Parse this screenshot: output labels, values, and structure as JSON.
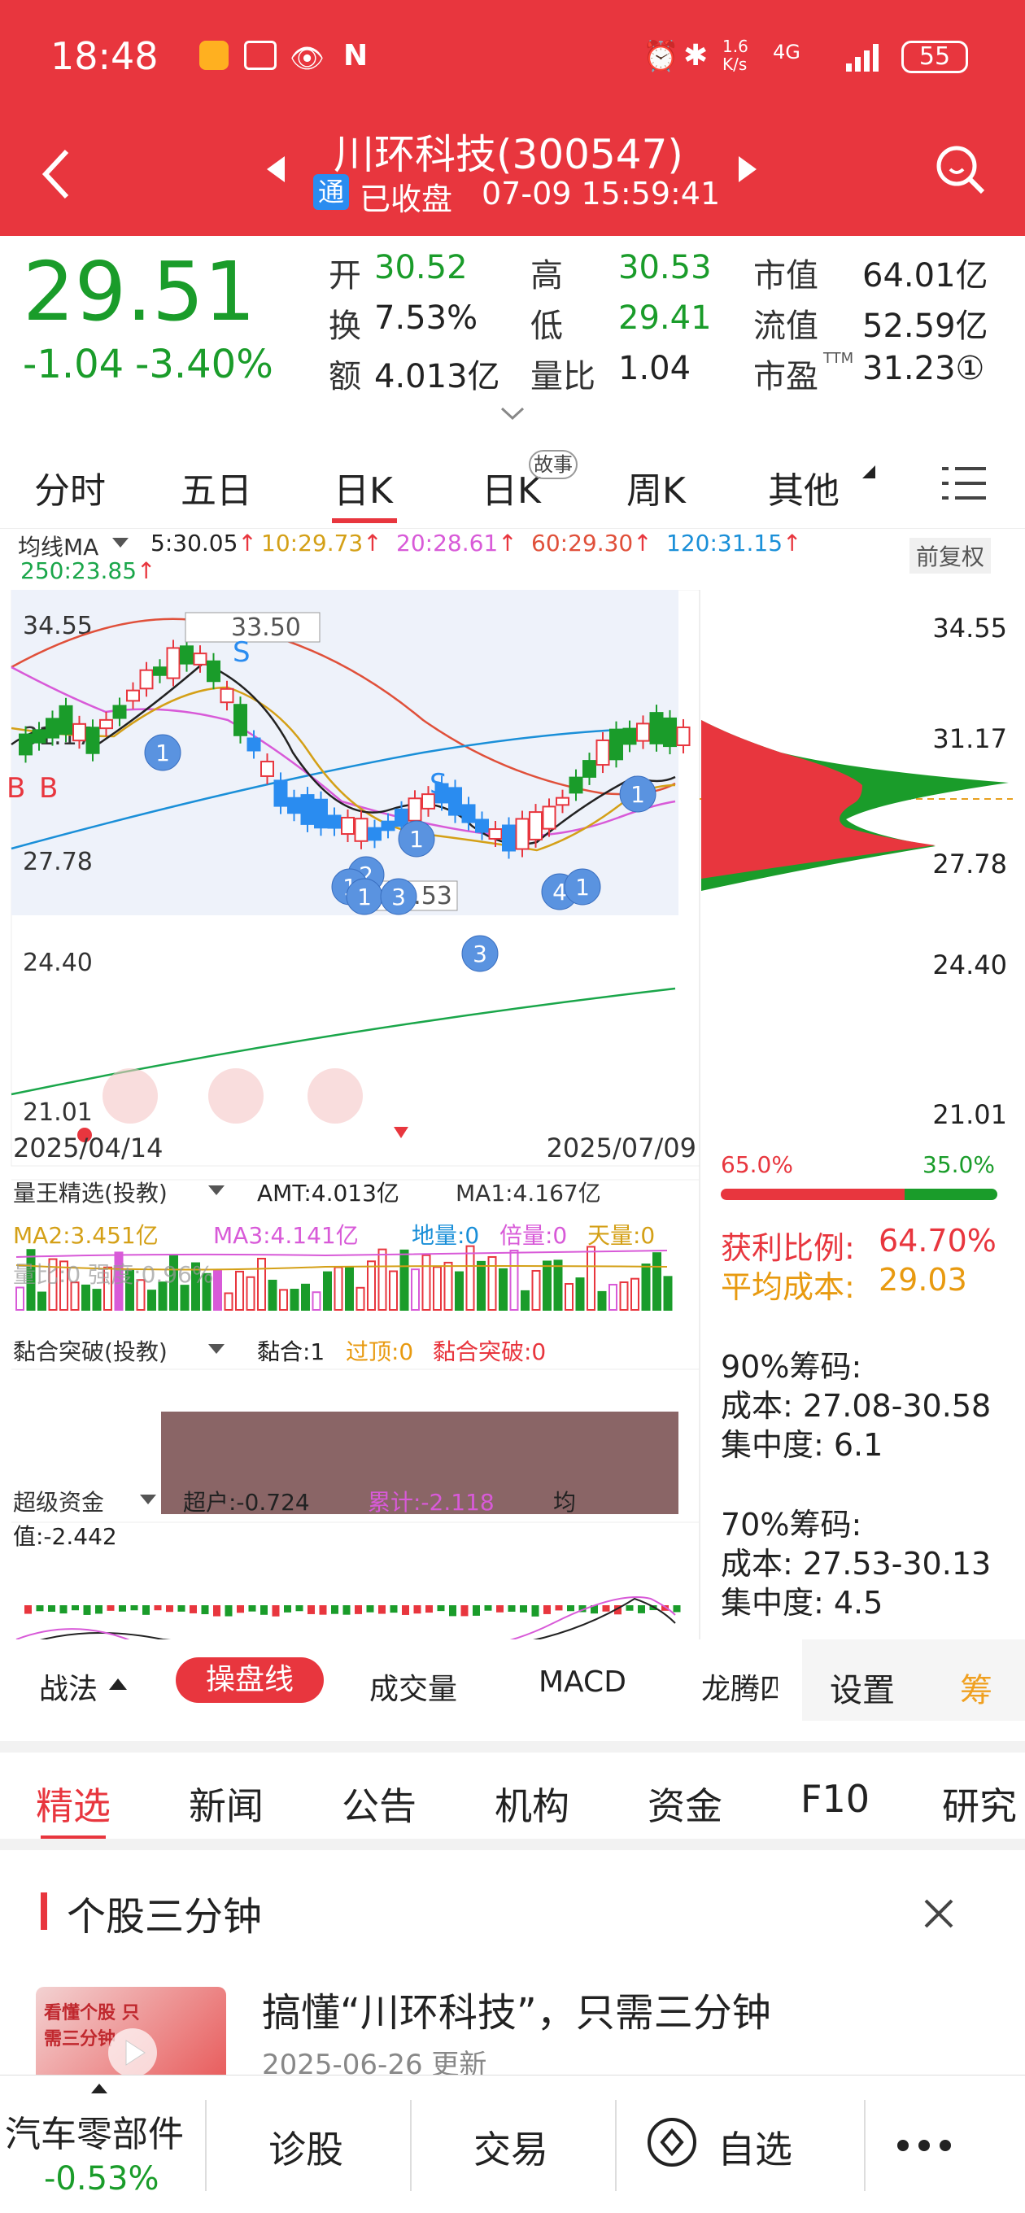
{
  "status": {
    "time": "18:48",
    "speed": "1.6\nK/s",
    "battery": "55",
    "net": "4G"
  },
  "header": {
    "title": "川环科技(300547)",
    "badge": "通",
    "state": "已收盘",
    "datetime": "07-09 15:59:41"
  },
  "quote": {
    "price": "29.51",
    "change": "-1.04",
    "pct": "-3.40%",
    "stats": [
      {
        "label": "开",
        "value": "30.52"
      },
      {
        "label": "高",
        "value": "30.53"
      },
      {
        "label": "市值",
        "value": "64.01亿"
      },
      {
        "label": "换",
        "value": "7.53%"
      },
      {
        "label": "低",
        "value": "29.41"
      },
      {
        "label": "流值",
        "value": "52.59亿"
      },
      {
        "label": "额",
        "value": "4.013亿"
      },
      {
        "label": "量比",
        "value": "1.04"
      },
      {
        "label": "市盈",
        "value": "31.23①"
      }
    ],
    "ttm": "TTM"
  },
  "tabs": [
    "分时",
    "五日",
    "日K",
    "日K",
    "周K",
    "其他"
  ],
  "tabs_badge": "故事",
  "ma": {
    "label": "均线MA",
    "items": [
      {
        "t": "5:30.05",
        "c": "#222"
      },
      {
        "t": "10:29.73",
        "c": "#d4a017"
      },
      {
        "t": "20:28.61",
        "c": "#d85ad8"
      },
      {
        "t": "60:29.30",
        "c": "#e0503a"
      },
      {
        "t": "120:31.15",
        "c": "#1a8fd8"
      },
      {
        "t": "250:23.85",
        "c": "#1aa64a"
      }
    ],
    "adj": "前复权"
  },
  "chart_data": {
    "type": "candlestick",
    "yticks": [
      "34.55",
      "31.17",
      "27.78",
      "24.40",
      "21.01"
    ],
    "dates": [
      "2025/04/14",
      "2025/07/09"
    ],
    "annot_high": "33.50",
    "annot_low": "26.53",
    "markers": [
      "B",
      "B",
      "S",
      "S"
    ],
    "bubbles": [
      "1",
      "1",
      "2",
      "1",
      "1",
      "3",
      "3",
      "4",
      "1",
      "1"
    ]
  },
  "chips": {
    "left_pct": "65.0%",
    "right_pct": "35.0%",
    "profit_label": "获利比例:",
    "profit": "64.70%",
    "avg_label": "平均成本:",
    "avg": "29.03",
    "c90": "90%筹码:",
    "c90cost": "成本: 27.08-30.58",
    "c90conc": "集中度: 6.1",
    "c70": "70%筹码:",
    "c70cost": "成本: 27.53-30.13",
    "c70conc": "集中度: 4.5"
  },
  "vol": {
    "name": "量王精选(投教)",
    "amt": "AMT:4.013亿",
    "ma1": "MA1:4.167亿",
    "ma2": "MA2:3.451亿",
    "ma3": "MA3:4.141亿",
    "di": "地量:0",
    "bei": "倍量:0",
    "tian": "天量:0",
    "row3": "量比:0 强度:0.96%"
  },
  "nian": {
    "name": "黏合突破(投教)",
    "a": "黏合:1",
    "b": "过顶:0",
    "c": "黏合突破:0"
  },
  "fund": {
    "name": "超级资金",
    "a": "超户:-0.724",
    "b": "累计:-2.118",
    "c": "均",
    "d": "值:-2.442"
  },
  "indtabs": [
    "战法",
    "操盘线",
    "成交量",
    "MACD",
    "龙腾四",
    "设置",
    "筹"
  ],
  "newstabs": [
    "精选",
    "新闻",
    "公告",
    "机构",
    "资金",
    "F10",
    "研究"
  ],
  "card": {
    "title": "个股三分钟",
    "headline": "搞懂“川环科技”，只需三分钟",
    "date": "2025-06-26 更新",
    "thumb": "看懂个股 只需三分钟"
  },
  "bottom": {
    "sector": "汽车零部件",
    "sector_pct": "-0.53%",
    "b1": "诊股",
    "b2": "交易",
    "b3": "自选"
  }
}
